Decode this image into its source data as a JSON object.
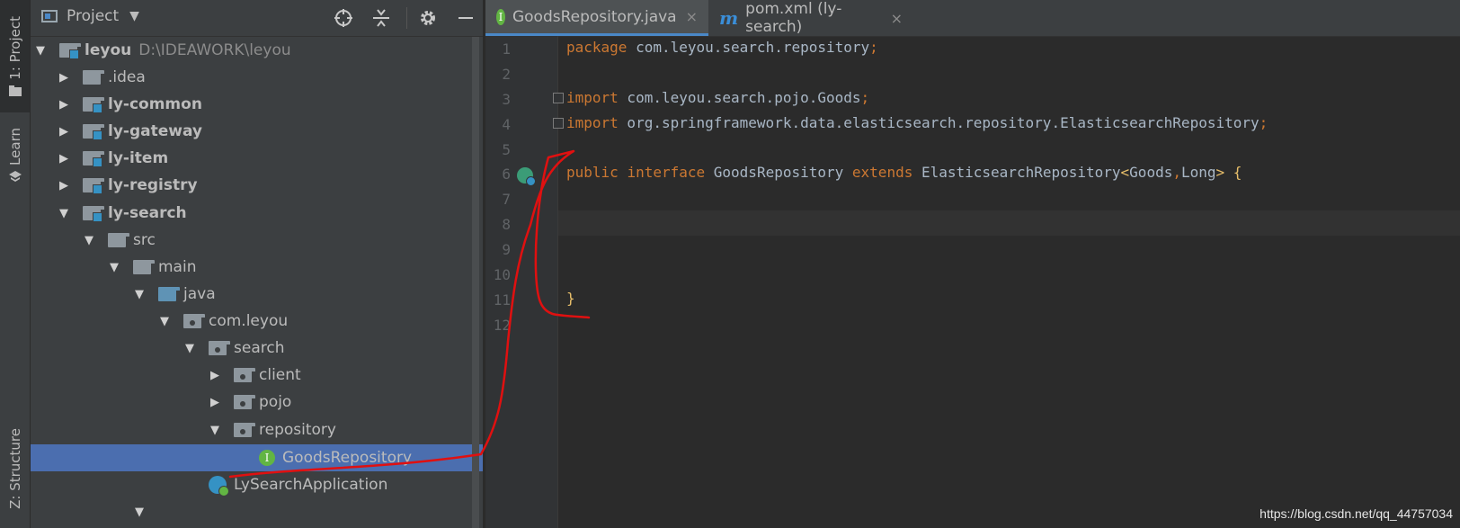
{
  "tool_strip": {
    "tabs": [
      {
        "label": "1: Project"
      },
      {
        "label": "Learn"
      },
      {
        "label": "Z: Structure"
      }
    ]
  },
  "project_panel": {
    "title": "Project",
    "tree": [
      {
        "label": "leyou",
        "path": "D:\\IDEAWORK\\leyou"
      },
      {
        "label": ".idea"
      },
      {
        "label": "ly-common"
      },
      {
        "label": "ly-gateway"
      },
      {
        "label": "ly-item"
      },
      {
        "label": "ly-registry"
      },
      {
        "label": "ly-search"
      },
      {
        "label": "src"
      },
      {
        "label": "main"
      },
      {
        "label": "java"
      },
      {
        "label": "com.leyou"
      },
      {
        "label": "search"
      },
      {
        "label": "client"
      },
      {
        "label": "pojo"
      },
      {
        "label": "repository"
      },
      {
        "label": "GoodsRepository"
      },
      {
        "label": "LySearchApplication"
      }
    ]
  },
  "editor": {
    "tabs": [
      {
        "label": "GoodsRepository.java",
        "icon": "I",
        "close": "×"
      },
      {
        "label": "pom.xml (ly-search)",
        "icon": "m",
        "close": "×"
      }
    ],
    "line_numbers": [
      "1",
      "2",
      "3",
      "4",
      "5",
      "6",
      "7",
      "8",
      "9",
      "10",
      "11",
      "12"
    ],
    "code": {
      "l1": {
        "kw": "package",
        "rest": " com.leyou.search.repository",
        "semi": ";"
      },
      "l3": {
        "kw": "import",
        "rest": " com.leyou.search.pojo.Goods",
        "semi": ";"
      },
      "l4": {
        "kw": "import",
        "rest": " org.springframework.data.elasticsearch.repository.ElasticsearchRepository",
        "semi": ";"
      },
      "l6": {
        "kw1": "public",
        "kw2": "interface",
        "name": " GoodsRepository ",
        "kw3": "extends",
        "base": " ElasticsearchRepository",
        "lt": "<",
        "t1": "Goods",
        "comma": ",",
        "t2": "Long",
        "gt": ">",
        "brace": " {"
      },
      "l11": {
        "brace": "}"
      }
    }
  },
  "watermark": "https://blog.csdn.net/qq_44757034",
  "colors": {
    "keyword": "#cc7832",
    "plain": "#a9b7c6",
    "selection": "#4b6eaf",
    "annotation": "#e01010"
  }
}
